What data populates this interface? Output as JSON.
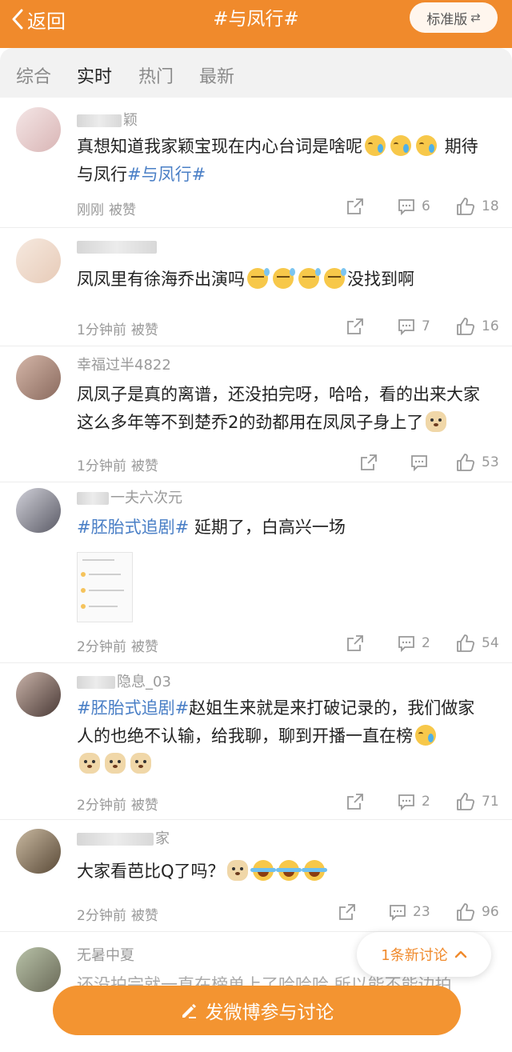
{
  "header": {
    "back_label": "返回",
    "title": "#与凤行#",
    "version_button": "标准版",
    "switch_glyph": "⇄"
  },
  "tabs": [
    "综合",
    "实时",
    "热门",
    "最新"
  ],
  "active_tab": "实时",
  "posts": [
    {
      "username": "颖",
      "text_parts": [
        "真想知道我家颖宝现在内心台词是啥呢",
        "期待与凤行"
      ],
      "hashtag": "#与凤行#",
      "emojis": [
        "cry-emoji",
        "cry-emoji",
        "cry-emoji"
      ],
      "time": "刚刚",
      "liked_label": "被赞",
      "comments": "6",
      "likes": "18"
    },
    {
      "username": "",
      "text_parts": [
        "凤凤里有徐海乔出演吗",
        "没找到啊"
      ],
      "emojis": [
        "sweat-emoji",
        "sweat-emoji",
        "sweat-emoji",
        "sweat-emoji"
      ],
      "time": "1分钟前",
      "liked_label": "被赞",
      "comments": "7",
      "likes": "16"
    },
    {
      "username": "幸福过半4822",
      "text": "凤凤子是真的离谱，还没拍完呀，哈哈，看的出来大家这么多年等不到楚乔2的劲都用在凤凤子身上了",
      "emojis": [
        "doge-emoji"
      ],
      "time": "1分钟前",
      "liked_label": "被赞",
      "comments": "",
      "likes": "53"
    },
    {
      "username": "一夫六次元",
      "hashtag": "#胚胎式追剧#",
      "text": " 延期了，白高兴一场",
      "time": "2分钟前",
      "liked_label": "被赞",
      "comments": "2",
      "likes": "54"
    },
    {
      "username": "隐息_03",
      "hashtag": "#胚胎式追剧#",
      "text": "赵姐生来就是来打破记录的，我们做家人的也绝不认输，给我聊，聊到开播一直在榜",
      "emojis": [
        "cry-emoji",
        "doge-emoji",
        "doge-emoji",
        "doge-emoji"
      ],
      "time": "2分钟前",
      "liked_label": "被赞",
      "comments": "2",
      "likes": "71"
    },
    {
      "username": "家",
      "text": "大家看芭比Q了吗？",
      "emojis": [
        "doge-emoji",
        "laugh-emoji",
        "laugh-emoji",
        "laugh-emoji"
      ],
      "time": "2分钟前",
      "liked_label": "被赞",
      "comments": "23",
      "likes": "96"
    },
    {
      "username": "无暑中夏",
      "text": "还没拍完就一直在榜单上了哈哈哈 所以能不能边拍"
    }
  ],
  "new_discussion": "1条新讨论",
  "compose_label": "发微博参与讨论"
}
